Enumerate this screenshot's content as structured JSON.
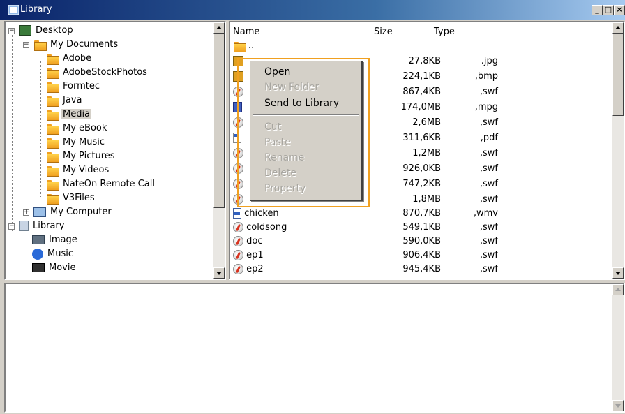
{
  "window": {
    "title": "Library"
  },
  "titlebar_buttons": {
    "minimize": "_",
    "maximize": "□",
    "close": "×"
  },
  "tree": {
    "desktop": "Desktop",
    "my_documents": "My Documents",
    "folders": [
      "Adobe",
      "AdobeStockPhotos",
      "Formtec",
      "Java",
      "Media",
      "My eBook",
      "My Music",
      "My Pictures",
      "My Videos",
      "NateOn Remote Call",
      "V3Files"
    ],
    "selected_folder": "Media",
    "my_computer": "My Computer",
    "library": "Library",
    "library_items": [
      "Image",
      "Music",
      "Movie"
    ]
  },
  "list": {
    "columns": {
      "name": "Name",
      "size": "Size",
      "type": "Type"
    },
    "parent_row": "..",
    "rows": [
      {
        "name": "",
        "size": "27,8KB",
        "type": ".jpg",
        "icon": "image-icon"
      },
      {
        "name": "",
        "size": "224,1KB",
        "type": ",bmp",
        "icon": "image-icon"
      },
      {
        "name": "",
        "size": "867,4KB",
        "type": ",swf",
        "icon": "flash-icon"
      },
      {
        "name": "",
        "size": "174,0MB",
        "type": ",mpg",
        "icon": "video-icon"
      },
      {
        "name": "",
        "size": "2,6MB",
        "type": ",swf",
        "icon": "flash-icon"
      },
      {
        "name": "",
        "size": "311,6KB",
        "type": ",pdf",
        "icon": "pdf-icon"
      },
      {
        "name": "",
        "size": "1,2MB",
        "type": ",swf",
        "icon": "flash-icon"
      },
      {
        "name": "",
        "size": "926,0KB",
        "type": ",swf",
        "icon": "flash-icon"
      },
      {
        "name": "",
        "size": "747,2KB",
        "type": ",swf",
        "icon": "flash-icon"
      },
      {
        "name": "",
        "size": "1,8MB",
        "type": ",swf",
        "icon": "flash-icon"
      },
      {
        "name": "chicken",
        "size": "870,7KB",
        "type": ",wmv",
        "icon": "wmv-icon"
      },
      {
        "name": "coldsong",
        "size": "549,1KB",
        "type": ",swf",
        "icon": "flash-icon"
      },
      {
        "name": "doc",
        "size": "590,0KB",
        "type": ",swf",
        "icon": "flash-icon"
      },
      {
        "name": "ep1",
        "size": "906,4KB",
        "type": ",swf",
        "icon": "flash-icon"
      },
      {
        "name": "ep2",
        "size": "945,4KB",
        "type": ",swf",
        "icon": "flash-icon"
      }
    ]
  },
  "context_menu": {
    "open": "Open",
    "new_folder": "New Folder",
    "send_to_library": "Send to Library",
    "cut": "Cut",
    "paste": "Paste",
    "rename": "Rename",
    "delete": "Delete",
    "property": "Property"
  },
  "colors": {
    "title_start": "#0a246a",
    "highlight": "#f0a020",
    "face": "#d4d0c8"
  }
}
